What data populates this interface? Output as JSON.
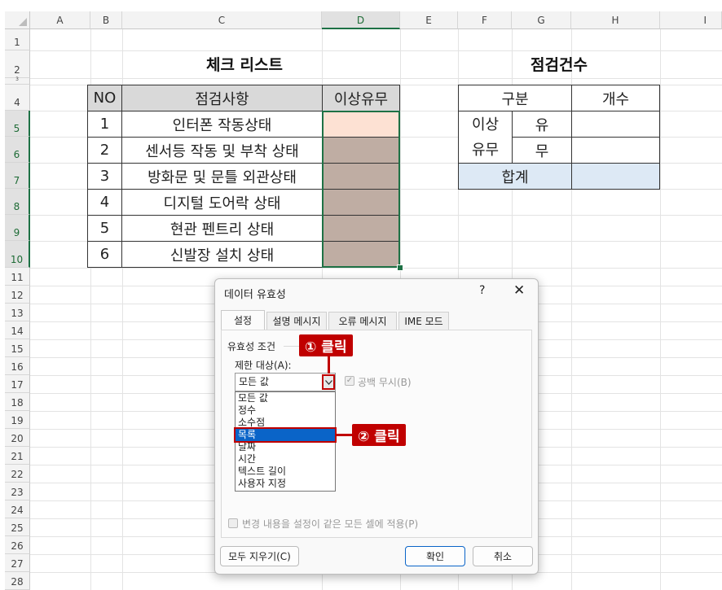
{
  "sheet": {
    "columns": [
      "A",
      "B",
      "C",
      "D",
      "E",
      "F",
      "G",
      "H",
      "I"
    ],
    "rows": [
      "1",
      "2",
      "3",
      "4",
      "5",
      "6",
      "7",
      "8",
      "9",
      "10",
      "11",
      "12",
      "13",
      "14",
      "15",
      "16",
      "17",
      "18",
      "19",
      "20",
      "21",
      "22",
      "23",
      "24",
      "25",
      "26",
      "27",
      "28"
    ]
  },
  "checklist": {
    "title": "체크 리스트",
    "headers": [
      "NO",
      "점검사항",
      "이상유무"
    ],
    "items": [
      {
        "no": "1",
        "text": "인터폰 작동상태"
      },
      {
        "no": "2",
        "text": "센서등 작동 및 부착 상태"
      },
      {
        "no": "3",
        "text": "방화문 및 문틀 외관상태"
      },
      {
        "no": "4",
        "text": "디지털 도어락 상태"
      },
      {
        "no": "5",
        "text": "현관 펜트리 상태"
      },
      {
        "no": "6",
        "text": "신발장 설치 상태"
      }
    ]
  },
  "summary": {
    "title": "점검건수",
    "header_category": "구분",
    "header_count": "개수",
    "group_label_line1": "이상",
    "group_label_line2": "유무",
    "row_yes": "유",
    "row_no": "무",
    "total": "합계"
  },
  "dialog": {
    "title": "데이터 유효성",
    "help": "?",
    "close": "✕",
    "tabs": [
      "설정",
      "설명 메시지",
      "오류 메시지",
      "IME 모드"
    ],
    "criteria_label": "유효성 조건",
    "allow_label": "제한 대상(A):",
    "allow_value": "모든 값",
    "ignore_blank": "공백 무시(B)",
    "options": [
      "모든 값",
      "정수",
      "소수점",
      "목록",
      "날짜",
      "시간",
      "텍스트 길이",
      "사용자 지정"
    ],
    "apply_all": "변경 내용을 설정이 같은 모든 셀에 적용(P)",
    "clear_all": "모두 지우기(C)",
    "ok": "확인",
    "cancel": "취소"
  },
  "callouts": {
    "step1": "① 클릭",
    "step2": "② 클릭"
  },
  "colors": {
    "accent_red": "#c00000",
    "highlight_blue": "#0a64c8",
    "selection_green": "#1e7145"
  }
}
